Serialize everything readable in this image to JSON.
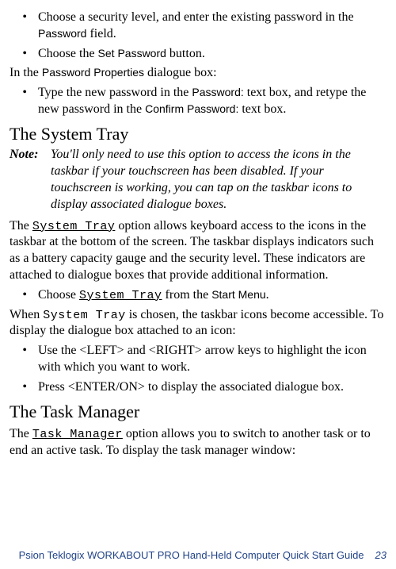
{
  "bullets1": {
    "b1a": "Choose a security level, and enter the existing password in the ",
    "b1b": "Password",
    "b1c": " field.",
    "b2a": "Choose the ",
    "b2b": "Set Password",
    "b2c": " button."
  },
  "para1": {
    "a": "In the ",
    "b": "Password Properties",
    "c": " dialogue box:"
  },
  "bullets2": {
    "b1a": "Type the new password in the ",
    "b1b": "Password:",
    "b1c": " text box, and retype the new password in the ",
    "b1d": "Confirm Password:",
    "b1e": " text box."
  },
  "h1": "The System Tray",
  "note": {
    "label": "Note:",
    "body": "You'll only need to use this option to access the icons in the taskbar if your touchscreen has been disabled. If your touchscreen is working, you can tap on the taskbar icons to display associated dialogue boxes."
  },
  "para2": {
    "a": "The ",
    "b": "System Tray",
    "c": " option  allows keyboard access to the icons in the taskbar at the bottom of the screen. The taskbar displays indica­tors such as a battery capacity gauge and the security level. These indicators are attached to dialogue boxes that provide additional information."
  },
  "bullets3": {
    "b1a": "Choose ",
    "b1b": "System Tray",
    "b1c": " from the ",
    "b1d": "Start Menu",
    "b1e": "."
  },
  "para3": {
    "a": "When ",
    "b": "System Tray",
    "c": " is chosen, the taskbar icons become accessi­ble. To display the dialogue box attached to an icon:"
  },
  "bullets4": {
    "b1": "Use the <LEFT> and <RIGHT> arrow keys to highlight the icon with which you want to work.",
    "b2": "Press <ENTER/ON> to display the associated dialogue box."
  },
  "h2": "The Task Manager",
  "para4": {
    "a": "The ",
    "b": "Task Manager",
    "c": " option allows you to switch to another task or to end an active task. To display the task manager window:"
  },
  "footer": {
    "title": "Psion Teklogix WORKABOUT PRO Hand-Held Computer Quick Start Guide",
    "page": "23"
  }
}
